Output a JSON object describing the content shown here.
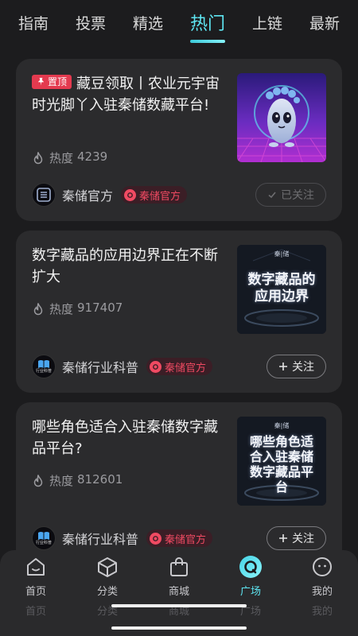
{
  "tabs": [
    {
      "label": "指南",
      "active": false
    },
    {
      "label": "投票",
      "active": false
    },
    {
      "label": "精选",
      "active": false
    },
    {
      "label": "热门",
      "active": true
    },
    {
      "label": "上链",
      "active": false
    },
    {
      "label": "最新",
      "active": false
    }
  ],
  "cards": [
    {
      "pin_label": "置顶",
      "title": "藏豆领取丨农业元宇宙时光脚丫入驻秦储数藏平台!",
      "heat_label": "热度",
      "heat_value": "4239",
      "author": "秦储官方",
      "official_label": "秦储官方",
      "follow_label": "已关注",
      "followed": true,
      "thumb_icon": "mascot-footprint-image"
    },
    {
      "title": "数字藏品的应用边界正在不断扩大",
      "heat_label": "热度",
      "heat_value": "917407",
      "author": "秦储行业科普",
      "official_label": "秦储官方",
      "follow_label": "关注",
      "followed": false,
      "thumb_text": "数字藏品的应用边界",
      "thumb_brand": "秦|储"
    },
    {
      "title": "哪些角色适合入驻秦储数字藏品平台?",
      "heat_label": "热度",
      "heat_value": "812601",
      "author": "秦储行业科普",
      "official_label": "秦储官方",
      "follow_label": "关注",
      "followed": false,
      "thumb_text": "哪些角色适合入驻秦储数字藏品平台",
      "thumb_brand": "秦|储"
    }
  ],
  "avatar_caption": "行业科普",
  "bottom_nav": [
    {
      "label": "首页",
      "icon": "home-icon",
      "active": false
    },
    {
      "label": "分类",
      "icon": "cube-icon",
      "active": false
    },
    {
      "label": "商城",
      "icon": "shopping-bag-icon",
      "active": false
    },
    {
      "label": "广场",
      "icon": "plaza-icon",
      "active": true
    },
    {
      "label": "我的",
      "icon": "profile-face-icon",
      "active": false
    }
  ],
  "colors": {
    "accent": "#5ee6f2",
    "pin": "#e33a4f",
    "official": "#f04a62",
    "background": "#1c1c1e",
    "card": "#2b2b2d"
  }
}
